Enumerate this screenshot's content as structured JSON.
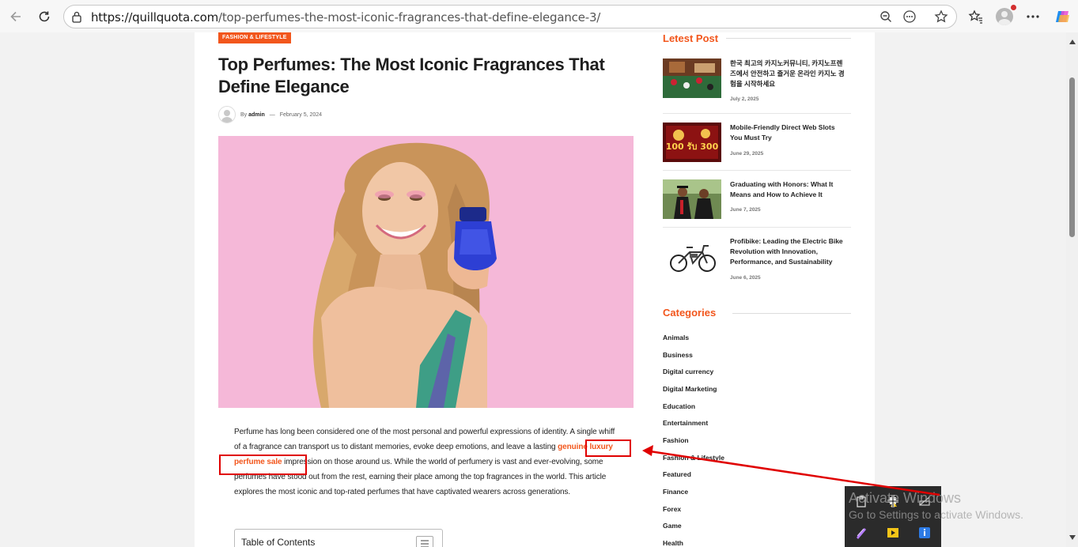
{
  "browser": {
    "url_domain": "https://quillquota.com",
    "url_path": "/top-perfumes-the-most-iconic-fragrances-that-define-elegance-3/"
  },
  "article": {
    "category": "FASHION & LIFESTYLE",
    "title": "Top Perfumes: The Most Iconic Fragrances That Define Elegance",
    "by_label": "By",
    "author": "admin",
    "separator": "—",
    "date": "February 5, 2024",
    "body_part1": "Perfume has long been considered one of the most personal and powerful expressions of identity. A single whiff of a fragrance can transport us to distant memories, evoke deep emotions, and leave a lasting ",
    "link_text": "genuine luxury perfume sale",
    "body_part2": " impression on those around us. While the world of perfumery is vast and ever-evolving, some perfumes have stood out from the rest, earning their place among the top fragrances in the world. This article explores the most iconic and top-rated perfumes that have captivated wearers across generations.",
    "toc_label": "Table of Contents"
  },
  "sidebar": {
    "latest_heading": "Letest Post",
    "posts": [
      {
        "title": "한국 최고의 카지노커뮤니티, 카지노프렌즈에서 안전하고 즐거운 온라인 카지노 경험을 시작하세요",
        "date": "July 2, 2025"
      },
      {
        "title": "Mobile-Friendly Direct Web Slots You Must Try",
        "date": "June 29, 2025"
      },
      {
        "title": "Graduating with Honors: What It Means and How to Achieve It",
        "date": "June 7, 2025"
      },
      {
        "title": "Profibike: Leading the Electric Bike Revolution with Innovation, Performance, and Sustainability",
        "date": "June 6, 2025"
      }
    ],
    "slot_thumb_text": "100 รับ 300",
    "categories_heading": "Categories",
    "categories": [
      "Animals",
      "Business",
      "Digital currency",
      "Digital Marketing",
      "Education",
      "Entertainment",
      "Fashion",
      "Fashion & Lifestyle",
      "Featured",
      "Finance",
      "Forex",
      "Game",
      "Health"
    ]
  },
  "os": {
    "watermark_title": "Activate Windows",
    "watermark_sub": "Go to Settings to activate Windows."
  },
  "colors": {
    "accent": "#f2561c",
    "annotation": "#e00000",
    "hero_bg": "#f5b8d8"
  }
}
